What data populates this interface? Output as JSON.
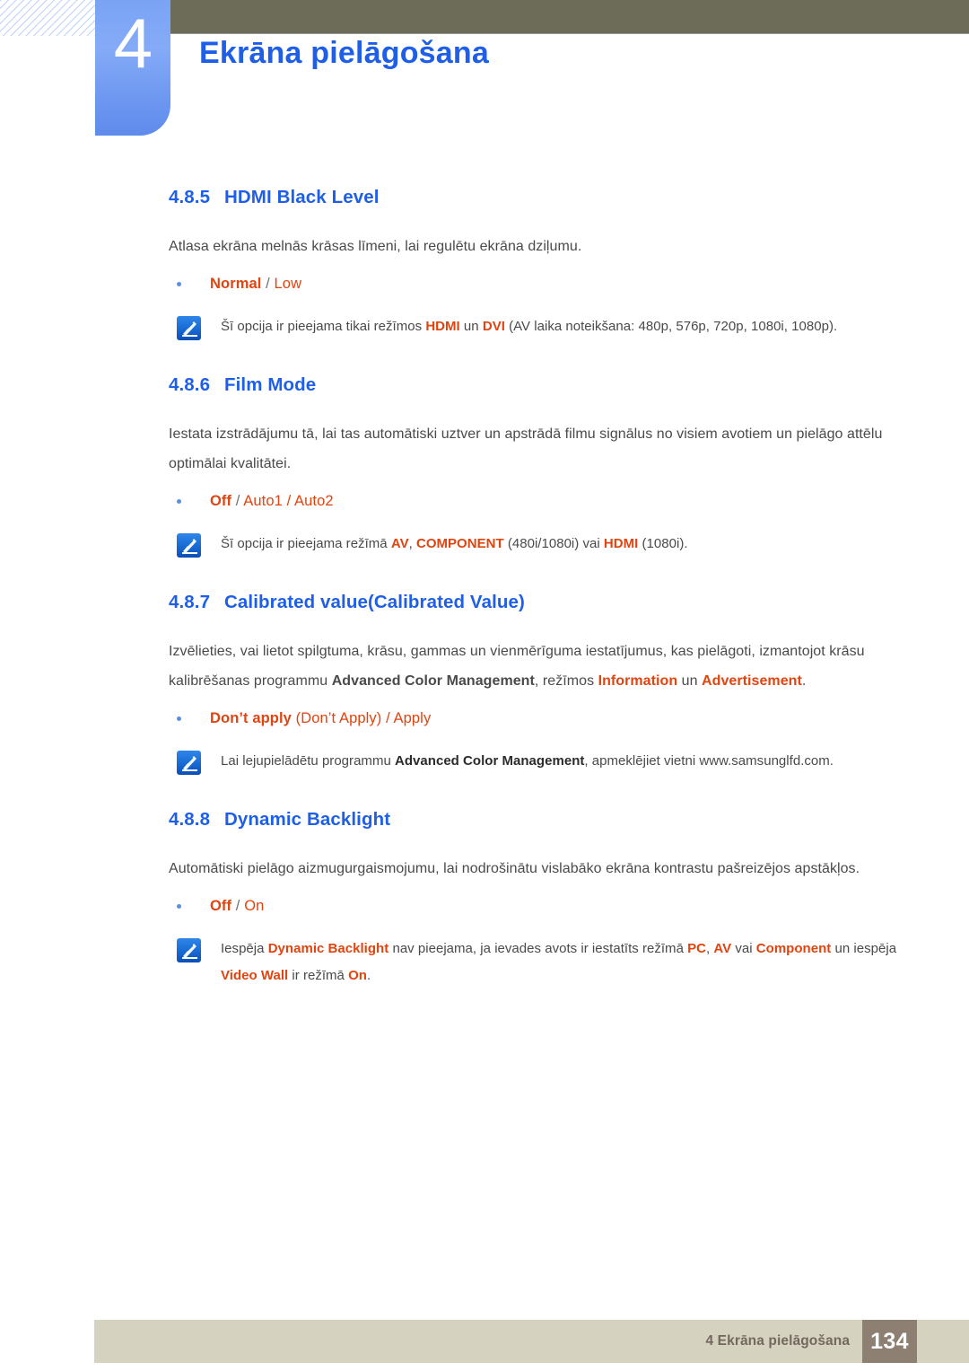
{
  "header": {
    "chapter_number": "4",
    "chapter_title": "Ekrāna pielāgošana",
    "accent_color": "#1f5fe8",
    "tab_color": "#7aa3f5",
    "bar_color": "#6d6c58"
  },
  "colors": {
    "heading_blue": "#1f5fe8",
    "option_orange": "#e2440f",
    "body_gray": "#4a4a4a",
    "footer_bar": "#d6d2c0",
    "footer_text": "#73685e",
    "footer_page_bg": "#8d7f72"
  },
  "sections": [
    {
      "number": "4.8.5",
      "title": "HDMI Black Level",
      "body": "Atlasa ekrāna melnās krāsas līmeni, lai regulētu ekrāna dziļumu.",
      "option": {
        "bold": "Normal",
        "sep": " / ",
        "light": "Low"
      },
      "note": {
        "icon": "note-pen-icon",
        "parts": [
          {
            "t": "Šī opcija ir pieejama tikai režīmos ",
            "s": "plain"
          },
          {
            "t": "HDMI",
            "s": "hl"
          },
          {
            "t": " un ",
            "s": "plain"
          },
          {
            "t": "DVI",
            "s": "hl"
          },
          {
            "t": " (AV laika noteikšana: 480p, 576p, 720p, 1080i, 1080p).",
            "s": "plain"
          }
        ]
      }
    },
    {
      "number": "4.8.6",
      "title": "Film Mode",
      "body": "Iestata izstrādājumu tā, lai tas automātiski uztver un apstrādā filmu signālus no visiem avotiem un pielāgo attēlu optimālai kvalitātei.",
      "option": {
        "bold": "Off",
        "sep": " / ",
        "light": "Auto1 / Auto2"
      },
      "note": {
        "icon": "note-pen-icon",
        "parts": [
          {
            "t": "Šī opcija ir pieejama režīmā ",
            "s": "plain"
          },
          {
            "t": "AV",
            "s": "hl"
          },
          {
            "t": ", ",
            "s": "plain"
          },
          {
            "t": "COMPONENT",
            "s": "hl"
          },
          {
            "t": " (480i/1080i) vai ",
            "s": "plain"
          },
          {
            "t": "HDMI",
            "s": "hl"
          },
          {
            "t": " (1080i).",
            "s": "plain"
          }
        ]
      }
    },
    {
      "number": "4.8.7",
      "title": "Calibrated value(Calibrated Value)",
      "body_parts": [
        {
          "t": "Izvēlieties, vai lietot spilgtuma, krāsu, gammas un vienmērīguma iestatījumus, kas pielāgoti, izmantojot krāsu kalibrēšanas programmu ",
          "s": "plain"
        },
        {
          "t": "Advanced Color Management",
          "s": "bold"
        },
        {
          "t": ", režīmos ",
          "s": "plain"
        },
        {
          "t": "Information",
          "s": "hl"
        },
        {
          "t": " un ",
          "s": "plain"
        },
        {
          "t": "Advertisement",
          "s": "hl"
        },
        {
          "t": ".",
          "s": "plain"
        }
      ],
      "option": {
        "bold": "Don’t apply",
        "sep": " ",
        "light": "(Don’t Apply) / Apply"
      },
      "note": {
        "icon": "note-pen-icon",
        "parts": [
          {
            "t": "Lai lejupielādētu programmu ",
            "s": "plain"
          },
          {
            "t": "Advanced Color Management",
            "s": "bold"
          },
          {
            "t": ", apmeklējiet vietni www.samsunglfd.com.",
            "s": "plain"
          }
        ]
      }
    },
    {
      "number": "4.8.8",
      "title": "Dynamic Backlight",
      "body": "Automātiski pielāgo aizmugurgaismojumu, lai nodrošinātu vislabāko ekrāna kontrastu pašreizējos apstākļos.",
      "option": {
        "bold": "Off",
        "sep": " / ",
        "light": "On"
      },
      "note": {
        "icon": "note-pen-icon",
        "parts": [
          {
            "t": "Iespēja ",
            "s": "plain"
          },
          {
            "t": "Dynamic Backlight",
            "s": "hl"
          },
          {
            "t": " nav pieejama, ja ievades avots ir iestatīts režīmā ",
            "s": "plain"
          },
          {
            "t": "PC",
            "s": "hl"
          },
          {
            "t": ", ",
            "s": "plain"
          },
          {
            "t": "AV",
            "s": "hl"
          },
          {
            "t": " vai ",
            "s": "plain"
          },
          {
            "t": "Component",
            "s": "hl"
          },
          {
            "t": " un iespēja ",
            "s": "plain"
          },
          {
            "t": "Video Wall",
            "s": "hl"
          },
          {
            "t": " ir režīmā ",
            "s": "plain"
          },
          {
            "t": "On",
            "s": "hl"
          },
          {
            "t": ".",
            "s": "plain"
          }
        ]
      }
    }
  ],
  "footer": {
    "label": "4 Ekrāna pielāgošana",
    "page_number": "134"
  }
}
